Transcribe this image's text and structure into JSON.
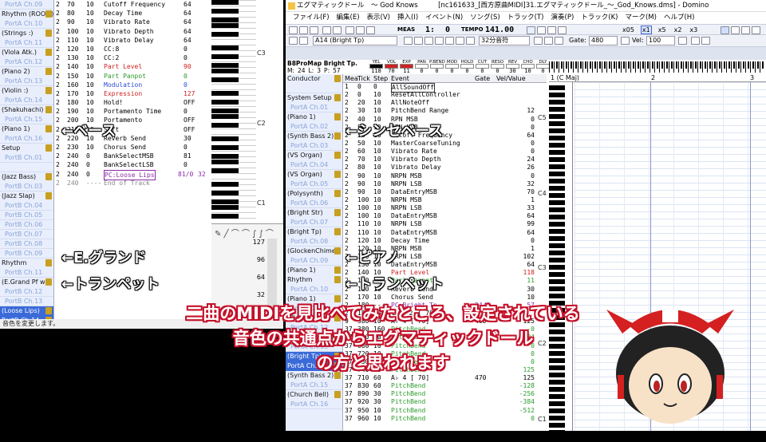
{
  "left_window": {
    "tracks": [
      {
        "label": "PortA Ch.09",
        "type": "port"
      },
      {
        "label": "Rhythm (ROOM)",
        "type": "name"
      },
      {
        "label": "PortA Ch.10",
        "type": "port"
      },
      {
        "label": "(Strings :)",
        "type": "name"
      },
      {
        "label": "PortA Ch.11",
        "type": "port"
      },
      {
        "label": "(Viola Atk.)",
        "type": "name"
      },
      {
        "label": "PortA Ch.12",
        "type": "port"
      },
      {
        "label": "(Piano 2)",
        "type": "name"
      },
      {
        "label": "PortA Ch.13",
        "type": "port"
      },
      {
        "label": "(Violin :)",
        "type": "name"
      },
      {
        "label": "PortA Ch.14",
        "type": "port"
      },
      {
        "label": "(Shakuhachi)",
        "type": "name"
      },
      {
        "label": "PortA Ch.15",
        "type": "port"
      },
      {
        "label": "(Piano 1)",
        "type": "name"
      },
      {
        "label": "PortA Ch.16",
        "type": "port"
      },
      {
        "label": "Setup",
        "type": "name"
      },
      {
        "label": "PortB Ch.01",
        "type": "port"
      },
      {
        "label": "",
        "type": "port"
      },
      {
        "label": "(Jazz Bass)",
        "type": "name"
      },
      {
        "label": "PortB Ch.03",
        "type": "port"
      },
      {
        "label": "(Jazz Slap)",
        "type": "name"
      },
      {
        "label": "PortB Ch.04",
        "type": "port"
      },
      {
        "label": "PortB Ch.05",
        "type": "port"
      },
      {
        "label": "PortB Ch.06",
        "type": "port"
      },
      {
        "label": "PortB Ch.07",
        "type": "port"
      },
      {
        "label": "PortB Ch.08",
        "type": "port"
      },
      {
        "label": "PortB Ch.09",
        "type": "port"
      },
      {
        "label": "Rhythm",
        "type": "name"
      },
      {
        "label": "PortB Ch.11",
        "type": "port"
      },
      {
        "label": "(E.Grand Pf w)",
        "type": "name"
      },
      {
        "label": "PortB Ch.12",
        "type": "port"
      },
      {
        "label": "PortB Ch.13",
        "type": "port"
      },
      {
        "label": "(Loose Lips)",
        "type": "sel"
      },
      {
        "label": "PortB Ch.14",
        "type": "sel"
      },
      {
        "label": "PortB Ch.15",
        "type": "port"
      },
      {
        "label": "PortB Ch.16",
        "type": "port"
      }
    ],
    "events": [
      [
        "2",
        "70",
        "10",
        "Cutoff Frequency",
        "64"
      ],
      [
        "2",
        "80",
        "10",
        "Decay Time",
        "64"
      ],
      [
        "2",
        "90",
        "10",
        "Vibrato Rate",
        "64"
      ],
      [
        "2",
        "100",
        "10",
        "Vibrato Depth",
        "64"
      ],
      [
        "2",
        "110",
        "10",
        "Vibrato Delay",
        "64"
      ],
      [
        "2",
        "120",
        "10",
        "CC:8",
        "0"
      ],
      [
        "2",
        "130",
        "10",
        "CC:2",
        "0"
      ],
      [
        "2",
        "140",
        "10",
        "Part Level",
        "90"
      ],
      [
        "2",
        "150",
        "10",
        "Part Panpot",
        "0"
      ],
      [
        "2",
        "160",
        "10",
        "Modulation",
        "0"
      ],
      [
        "2",
        "170",
        "10",
        "Expression",
        "127"
      ],
      [
        "2",
        "180",
        "10",
        "Hold!",
        "OFF"
      ],
      [
        "2",
        "190",
        "10",
        "Portamento Time",
        "0"
      ],
      [
        "2",
        "200",
        "10",
        "Portamento",
        "OFF"
      ],
      [
        "2",
        "210",
        "10",
        "Soft",
        "OFF"
      ],
      [
        "2",
        "220",
        "10",
        "Reverb Send",
        "30"
      ],
      [
        "2",
        "230",
        "10",
        "Chorus Send",
        "0"
      ],
      [
        "2",
        "240",
        "0",
        "BankSelectMSB",
        "81"
      ],
      [
        "2",
        "240",
        "0",
        "BankSelectLSB",
        "0"
      ],
      [
        "2",
        "240",
        "0",
        "PC:Loose Lips",
        "81/0",
        "32"
      ],
      [
        "2",
        "240",
        "----",
        "End of Track",
        ""
      ]
    ],
    "piano_labels": [
      "C3",
      "C2",
      "C1"
    ],
    "ctrl_ticks": [
      "127",
      "96",
      "64",
      "32"
    ],
    "status": "音色を変更します。"
  },
  "main_window": {
    "title": "エグマティックドール　～ God Knows　　　[nc161633_[西方原曲MIDI]31.エグマティックドール_～_God_Knows.dms] - Domino",
    "menu": [
      "ファイル(F)",
      "編集(E)",
      "表示(V)",
      "挿入(I)",
      "イベント(N)",
      "ソング(S)",
      "トラック(T)",
      "演奏(P)",
      "トラック(K)",
      "マーク(M)",
      "ヘルプ(H)"
    ],
    "toolbar": {
      "meas_label": "MEAS",
      "meas_value": "1:",
      "tick_value": "0",
      "tempo_label": "TEMPO",
      "tempo_value": "141.00",
      "zoom": [
        "x05",
        "x1",
        "x5",
        "x2",
        "x3"
      ]
    },
    "toolbar2": {
      "instrument": "A14 (Bright Tp)",
      "quantize": "32分音符",
      "gate_label": "Gate:",
      "gate_value": "480",
      "vel_label": "Vel:",
      "vel_value": "100"
    },
    "meter": {
      "map_name": "B8ProMap Bright Tp.",
      "m_label": "M:",
      "m_val": "24",
      "l_label": "L:",
      "l_val": "3",
      "p_label": "P:",
      "p_val": "57",
      "values": [
        "118",
        "70",
        "11",
        "0",
        "0",
        "0",
        "0",
        "0",
        "0",
        "30",
        "10",
        "0"
      ],
      "headers": [
        "YEL",
        "VOL",
        "EXP",
        "PAN",
        "P.BEND",
        "MOD",
        "HOLD",
        "CUT",
        "RESO",
        "REV",
        "CHO",
        "DLY"
      ]
    },
    "tracks": [
      {
        "label": "Conductor",
        "type": "name"
      },
      {
        "label": "",
        "type": "port"
      },
      {
        "label": "System Setup",
        "type": "name"
      },
      {
        "label": "PortA Ch.01",
        "type": "port"
      },
      {
        "label": "(Piano 1)",
        "type": "name"
      },
      {
        "label": "PortA Ch.02",
        "type": "port"
      },
      {
        "label": "(Synth Bass 2)",
        "type": "name"
      },
      {
        "label": "PortA Ch.03",
        "type": "port"
      },
      {
        "label": "(VS Organ)",
        "type": "name"
      },
      {
        "label": "PortA Ch.04",
        "type": "port"
      },
      {
        "label": "(VS Organ)",
        "type": "name"
      },
      {
        "label": "PortA Ch.05",
        "type": "port"
      },
      {
        "label": "(Polysynth)",
        "type": "name"
      },
      {
        "label": "PortA Ch.06",
        "type": "port"
      },
      {
        "label": "(Bright Str)",
        "type": "name"
      },
      {
        "label": "PortA Ch.07",
        "type": "port"
      },
      {
        "label": "(Bright Tp)",
        "type": "name"
      },
      {
        "label": "PortA Ch.08",
        "type": "port"
      },
      {
        "label": "(GlockenChime)",
        "type": "name"
      },
      {
        "label": "PortA Ch.09",
        "type": "port"
      },
      {
        "label": "(Piano 1)",
        "type": "name"
      },
      {
        "label": "Rhythm",
        "type": "name"
      },
      {
        "label": "PortA Ch.10",
        "type": "port"
      },
      {
        "label": "(Piano 1)",
        "type": "name"
      },
      {
        "label": "PortA Ch.11",
        "type": "port"
      },
      {
        "label": "(Piano 2)",
        "type": "name"
      },
      {
        "label": "PortA Ch.12",
        "type": "port"
      },
      {
        "label": "(Synth Bass 2)",
        "type": "name"
      },
      {
        "label": "PortA Ch.13",
        "type": "port"
      },
      {
        "label": "(Bright Tp)",
        "type": "sel"
      },
      {
        "label": "PortA Ch.14",
        "type": "sel"
      },
      {
        "label": "(Synth Bass 2)",
        "type": "name"
      },
      {
        "label": "PortA Ch.15",
        "type": "port"
      },
      {
        "label": "(Church Bell)",
        "type": "name"
      },
      {
        "label": "PortA Ch.16",
        "type": "port"
      }
    ],
    "event_headers": [
      "Mea",
      "Tick",
      "Step",
      "Event",
      "Gate",
      "Vel/Value"
    ],
    "events": [
      [
        "1",
        "0",
        "0",
        "AllSoundOff",
        "",
        ""
      ],
      [
        "2",
        "0",
        "10",
        "ResetAllController",
        "",
        ""
      ],
      [
        "2",
        "20",
        "10",
        "AllNoteOff",
        "",
        ""
      ],
      [
        "2",
        "30",
        "10",
        "PitchBend Range",
        "",
        "12"
      ],
      [
        "2",
        "40",
        "10",
        "RPN MSB",
        "",
        "0"
      ],
      [
        "2",
        "50",
        "10",
        "RPN LSB",
        "",
        "0"
      ],
      [
        "2",
        "50",
        "10",
        "Cutoff Frequency",
        "",
        "64"
      ],
      [
        "2",
        "50",
        "10",
        "MasterCoarseTuning",
        "",
        "0"
      ],
      [
        "2",
        "60",
        "10",
        "Vibrato Rate",
        "",
        "0"
      ],
      [
        "2",
        "70",
        "10",
        "Vibrato Depth",
        "",
        "24"
      ],
      [
        "2",
        "80",
        "10",
        "Vibrato Delay",
        "",
        "26"
      ],
      [
        "2",
        "90",
        "10",
        "NRPN MSB",
        "",
        "0"
      ],
      [
        "2",
        "90",
        "10",
        "NRPN LSB",
        "",
        "32"
      ],
      [
        "2",
        "90",
        "10",
        "DataEntryMSB",
        "",
        "70"
      ],
      [
        "2",
        "100",
        "10",
        "NRPN MSB",
        "",
        "1"
      ],
      [
        "2",
        "100",
        "10",
        "NRPN LSB",
        "",
        "33"
      ],
      [
        "2",
        "100",
        "10",
        "DataEntryMSB",
        "",
        "64"
      ],
      [
        "2",
        "110",
        "10",
        "NRPN LSB",
        "",
        "99"
      ],
      [
        "2",
        "110",
        "10",
        "DataEntryMSB",
        "",
        "64"
      ],
      [
        "2",
        "120",
        "10",
        "Decay Time",
        "",
        "0"
      ],
      [
        "2",
        "120",
        "10",
        "NRPN MSB",
        "",
        "1"
      ],
      [
        "2",
        "130",
        "10",
        "NRPN LSB",
        "",
        "102"
      ],
      [
        "2",
        "130",
        "10",
        "DataEntryMSB",
        "",
        "64"
      ],
      [
        "2",
        "140",
        "10",
        "Part Level",
        "",
        "118"
      ],
      [
        "2",
        "150",
        "10",
        "Part Panpot",
        "",
        "11"
      ],
      [
        "2",
        "160",
        "10",
        "Reverb Send",
        "",
        "30"
      ],
      [
        "2",
        "170",
        "10",
        "Chorus Send",
        "",
        "10"
      ],
      [
        "2",
        "180",
        "----",
        "PC:Bright Tp.",
        "24/3",
        "57"
      ],
      [
        "2",
        "185",
        "10",
        "ＢＯ ２ [ 70]",
        "",
        ""
      ],
      [
        "9",
        "380",
        "10",
        "A♭ 4 [ 70]",
        "400",
        "125"
      ],
      [
        "37",
        "380",
        "160",
        "PitchBend",
        "",
        "-0"
      ],
      [
        "37",
        "660",
        "10",
        "PitchBend",
        "",
        "-384"
      ],
      [
        "37",
        "680",
        "10",
        "PitchBend",
        "",
        "0"
      ],
      [
        "37",
        "720",
        "10",
        "PitchBend",
        "",
        "0"
      ],
      [
        "37",
        "730",
        "10",
        "PitchBend",
        "",
        "0"
      ],
      [
        "37",
        "740",
        "10",
        "PitchBend",
        "",
        "125"
      ],
      [
        "37",
        "710",
        "60",
        "A♭ 4 [ 70]",
        "470",
        "125"
      ],
      [
        "37",
        "830",
        "60",
        "PitchBend",
        "",
        "-128"
      ],
      [
        "37",
        "890",
        "30",
        "PitchBend",
        "",
        "-256"
      ],
      [
        "37",
        "920",
        "30",
        "PitchBend",
        "",
        "-384"
      ],
      [
        "37",
        "950",
        "10",
        "PitchBend",
        "",
        "-512"
      ],
      [
        "37",
        "960",
        "10",
        "PitchBend",
        "",
        "0"
      ]
    ],
    "ruler": [
      "1 (C Maj)",
      "2",
      "3"
    ],
    "piano_labels": [
      "C5",
      "C4",
      "C3",
      "C2",
      "C1"
    ]
  },
  "annotations": {
    "bass_left": "←ベース",
    "egrand_left": "←E.グランド",
    "trumpet_left": "←トランペット",
    "synth_bass_right": "←シンセベース",
    "piano_right": "←ピアノ",
    "trumpet_right": "←トランペット"
  },
  "caption": {
    "line1": "二曲のMIDIを見比べてみたところ、設定されている",
    "line2": "音色の共通点からエグマティックドール",
    "line3": "の方と思われます"
  },
  "colors": {
    "selected": "#3a6ad8",
    "track_bg": "#e8eefc",
    "caption_outline": "#c4112a",
    "part_level": "#d02020",
    "pitchbend": "#2a9a2a"
  }
}
